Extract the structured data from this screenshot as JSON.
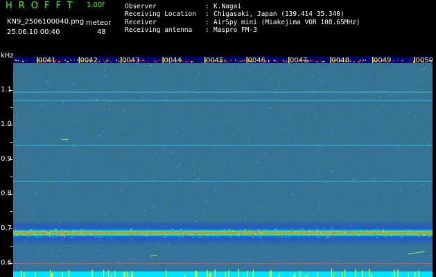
{
  "header": {
    "app_name": "HROFFT",
    "version": "1.00f",
    "filename": "KN9_2506100040.png",
    "meteor_label": "meteor",
    "datetime": "25.06.10 00:40",
    "meteor_count": "48"
  },
  "info": [
    {
      "label": "Observer",
      "value": "K.Nagai"
    },
    {
      "label": "Receiving Location",
      "value": "Chigasaki, Japan (139.414 35.340)"
    },
    {
      "label": "Receiver",
      "value": "AirSpy mini (Miakejima VOR 108.65MHz)"
    },
    {
      "label": "Receiving antenna",
      "value": "Maspro FM-3"
    }
  ],
  "axis": {
    "unit": "kHz",
    "y_labels": [
      "1.1",
      "1.0",
      "0.9",
      "0.8",
      "0.7",
      "0.6"
    ],
    "minute_labels": [
      "0041",
      "0042",
      "0043",
      "0044",
      "0045",
      "0046",
      "0047",
      "0048",
      "0049",
      "0050"
    ]
  },
  "colors": {
    "header_green": "#39ff14",
    "background": "#000000",
    "waterfall_base": "#000070",
    "baseline_cyan": "#00e5ff"
  },
  "spectrogram": {
    "view_hz": [
      580,
      1185
    ],
    "carrier_hz": 701,
    "lines_hz": [
      1088,
      1065,
      843,
      942,
      1182
    ]
  }
}
